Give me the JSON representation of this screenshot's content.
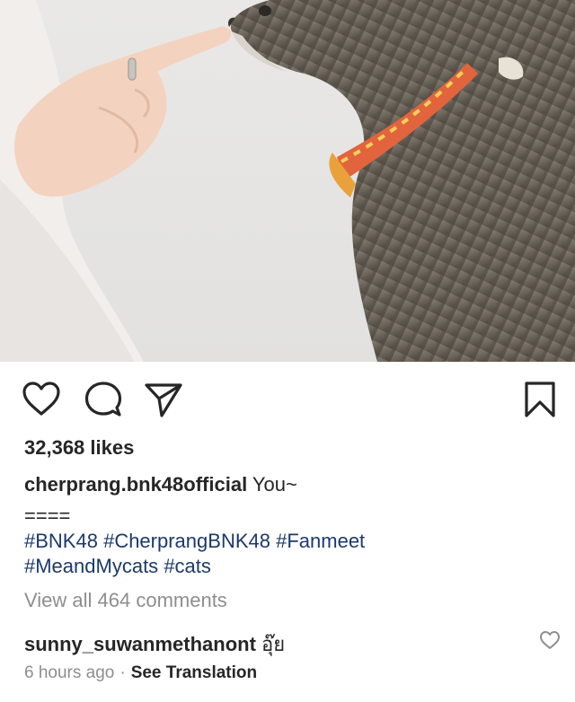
{
  "post": {
    "likes_text": "32,368 likes",
    "caption_user": "cherprang.bnk48official",
    "caption_text": "You~",
    "separator_line": "====",
    "hashtags_line1": [
      "#BNK48",
      "#CherprangBNK48",
      "#Fanmeet"
    ],
    "hashtags_line2": [
      "#MeandMycats",
      "#cats"
    ],
    "view_comments": "View all 464 comments"
  },
  "comment": {
    "user": "sunny_suwanmethanont",
    "text": "อุ๊ย",
    "time": "6 hours ago",
    "separator": "·",
    "translate": "See Translation"
  },
  "icons": {
    "like": "heart-icon",
    "comment": "comment-bubble-icon",
    "share": "paper-plane-icon",
    "save": "bookmark-icon",
    "comment_like": "small-heart-icon"
  },
  "colors": {
    "text": "#262626",
    "secondary": "#8e8e8e",
    "hashtag": "#1b3a6b"
  }
}
